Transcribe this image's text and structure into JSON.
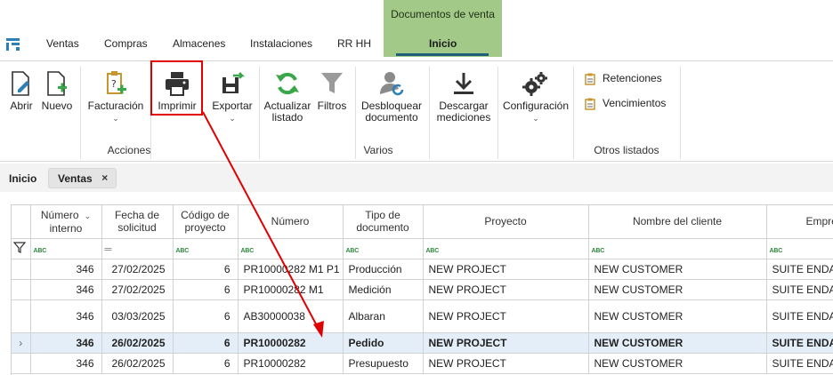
{
  "nav": {
    "context_title": "Documentos de venta",
    "tabs": [
      "Ventas",
      "Compras",
      "Almacenes",
      "Instalaciones",
      "RR HH",
      "Inicio"
    ],
    "active_tab": "Inicio"
  },
  "ribbon": {
    "abrir": "Abrir",
    "nuevo": "Nuevo",
    "facturacion": "Facturación",
    "imprimir": "Imprimir",
    "exportar": "Exportar",
    "actualizar_1": "Actualizar",
    "actualizar_2": "listado",
    "filtros": "Filtros",
    "desbloquear_1": "Desbloquear",
    "desbloquear_2": "documento",
    "descargar_1": "Descargar",
    "descargar_2": "mediciones",
    "configuracion": "Configuración",
    "retenciones": "Retenciones",
    "vencimientos": "Vencimientos",
    "groups": {
      "acciones": "Acciones",
      "varios": "Varios",
      "otros": "Otros listados"
    }
  },
  "breadcrumb": {
    "home": "Inicio",
    "tab": "Ventas",
    "close": "×"
  },
  "grid": {
    "headers": {
      "numero_interno_1": "Número",
      "numero_interno_2": "interno",
      "fecha_1": "Fecha de",
      "fecha_2": "solicitud",
      "codigo_1": "Código de",
      "codigo_2": "proyecto",
      "numero": "Número",
      "tipo_1": "Tipo de",
      "tipo_2": "documento",
      "proyecto": "Proyecto",
      "cliente": "Nombre del cliente",
      "empresa": "Empre"
    },
    "filter_abc": "ABC",
    "filter_eq": "═",
    "rows": [
      {
        "interno": "346",
        "fecha": "27/02/2025",
        "codigo": "6",
        "numero": "PR10000282 M1 P1",
        "tipo": "Producción",
        "proyecto": "NEW PROJECT",
        "cliente": "NEW CUSTOMER",
        "empresa": "SUITE ENDA"
      },
      {
        "interno": "346",
        "fecha": "27/02/2025",
        "codigo": "6",
        "numero": "PR10000282 M1",
        "tipo": "Medición",
        "proyecto": "NEW PROJECT",
        "cliente": "NEW CUSTOMER",
        "empresa": "SUITE ENDA"
      },
      {
        "interno": "346",
        "fecha": "03/03/2025",
        "codigo": "6",
        "numero": "AB30000038",
        "tipo": "Albaran",
        "proyecto": "NEW PROJECT",
        "cliente": "NEW CUSTOMER",
        "empresa": "SUITE ENDA"
      },
      {
        "interno": "346",
        "fecha": "26/02/2025",
        "codigo": "6",
        "numero": "PR10000282",
        "tipo": "Pedido",
        "proyecto": "NEW PROJECT",
        "cliente": "NEW CUSTOMER",
        "empresa": "SUITE ENDA"
      },
      {
        "interno": "346",
        "fecha": "26/02/2025",
        "codigo": "6",
        "numero": "PR10000282",
        "tipo": "Presupuesto",
        "proyecto": "NEW PROJECT",
        "cliente": "NEW CUSTOMER",
        "empresa": "SUITE ENDA"
      }
    ],
    "selected_marker": "›"
  },
  "colors": {
    "context_green": "#a3c988",
    "highlight_red": "#e00000",
    "selected_row": "#e3eef9",
    "accent_blue": "#1f5e7a"
  },
  "icons": [
    "app-logo-icon",
    "open-doc-icon",
    "new-doc-icon",
    "invoice-icon",
    "printer-icon",
    "export-icon",
    "refresh-icon",
    "funnel-icon",
    "user-unlock-icon",
    "download-icon",
    "gears-icon",
    "clipboard-icon",
    "filter-icon"
  ]
}
